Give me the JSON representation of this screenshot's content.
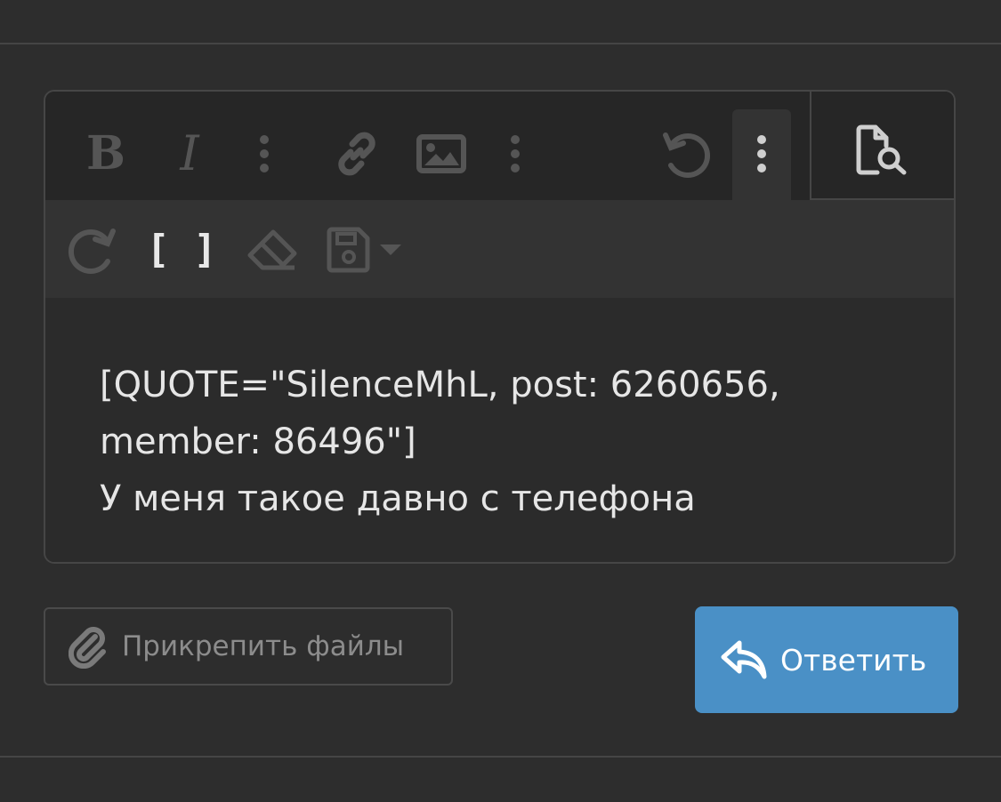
{
  "editor": {
    "toolbar_row1": [
      {
        "name": "bold",
        "icon": "bold-icon",
        "glyph": "B"
      },
      {
        "name": "italic",
        "icon": "italic-icon",
        "glyph": "I"
      },
      {
        "name": "more-text",
        "icon": "vertical-ellipsis-icon"
      },
      {
        "name": "link",
        "icon": "link-icon"
      },
      {
        "name": "image",
        "icon": "image-icon"
      },
      {
        "name": "more-insert",
        "icon": "vertical-ellipsis-icon"
      },
      {
        "name": "undo",
        "icon": "undo-icon"
      },
      {
        "name": "more-misc",
        "icon": "vertical-ellipsis-icon",
        "active": true
      },
      {
        "name": "preview",
        "icon": "file-search-icon"
      }
    ],
    "toolbar_row2": [
      {
        "name": "redo",
        "icon": "redo-icon"
      },
      {
        "name": "toggle-bbcode",
        "icon": "brackets-icon",
        "glyph": "[ ]",
        "active": true
      },
      {
        "name": "remove-format",
        "icon": "eraser-icon"
      },
      {
        "name": "drafts",
        "icon": "save-icon"
      }
    ],
    "content_lines": [
      "[QUOTE=\"SilenceMhL, post: 6260656,",
      "member: 86496\"]",
      "У меня такое давно с телефона"
    ]
  },
  "actions": {
    "attach_label": "Прикрепить файлы",
    "attach_icon": "paperclip-icon",
    "reply_label": "Ответить",
    "reply_icon": "reply-icon"
  },
  "colors": {
    "background": "#2d2d2d",
    "toolbar": "#262626",
    "toolbar_row2": "#333333",
    "icon_disabled": "#5a5a5a",
    "icon_active": "#e8e8e8",
    "text": "#e6e6e6",
    "accent": "#4a90c6"
  }
}
